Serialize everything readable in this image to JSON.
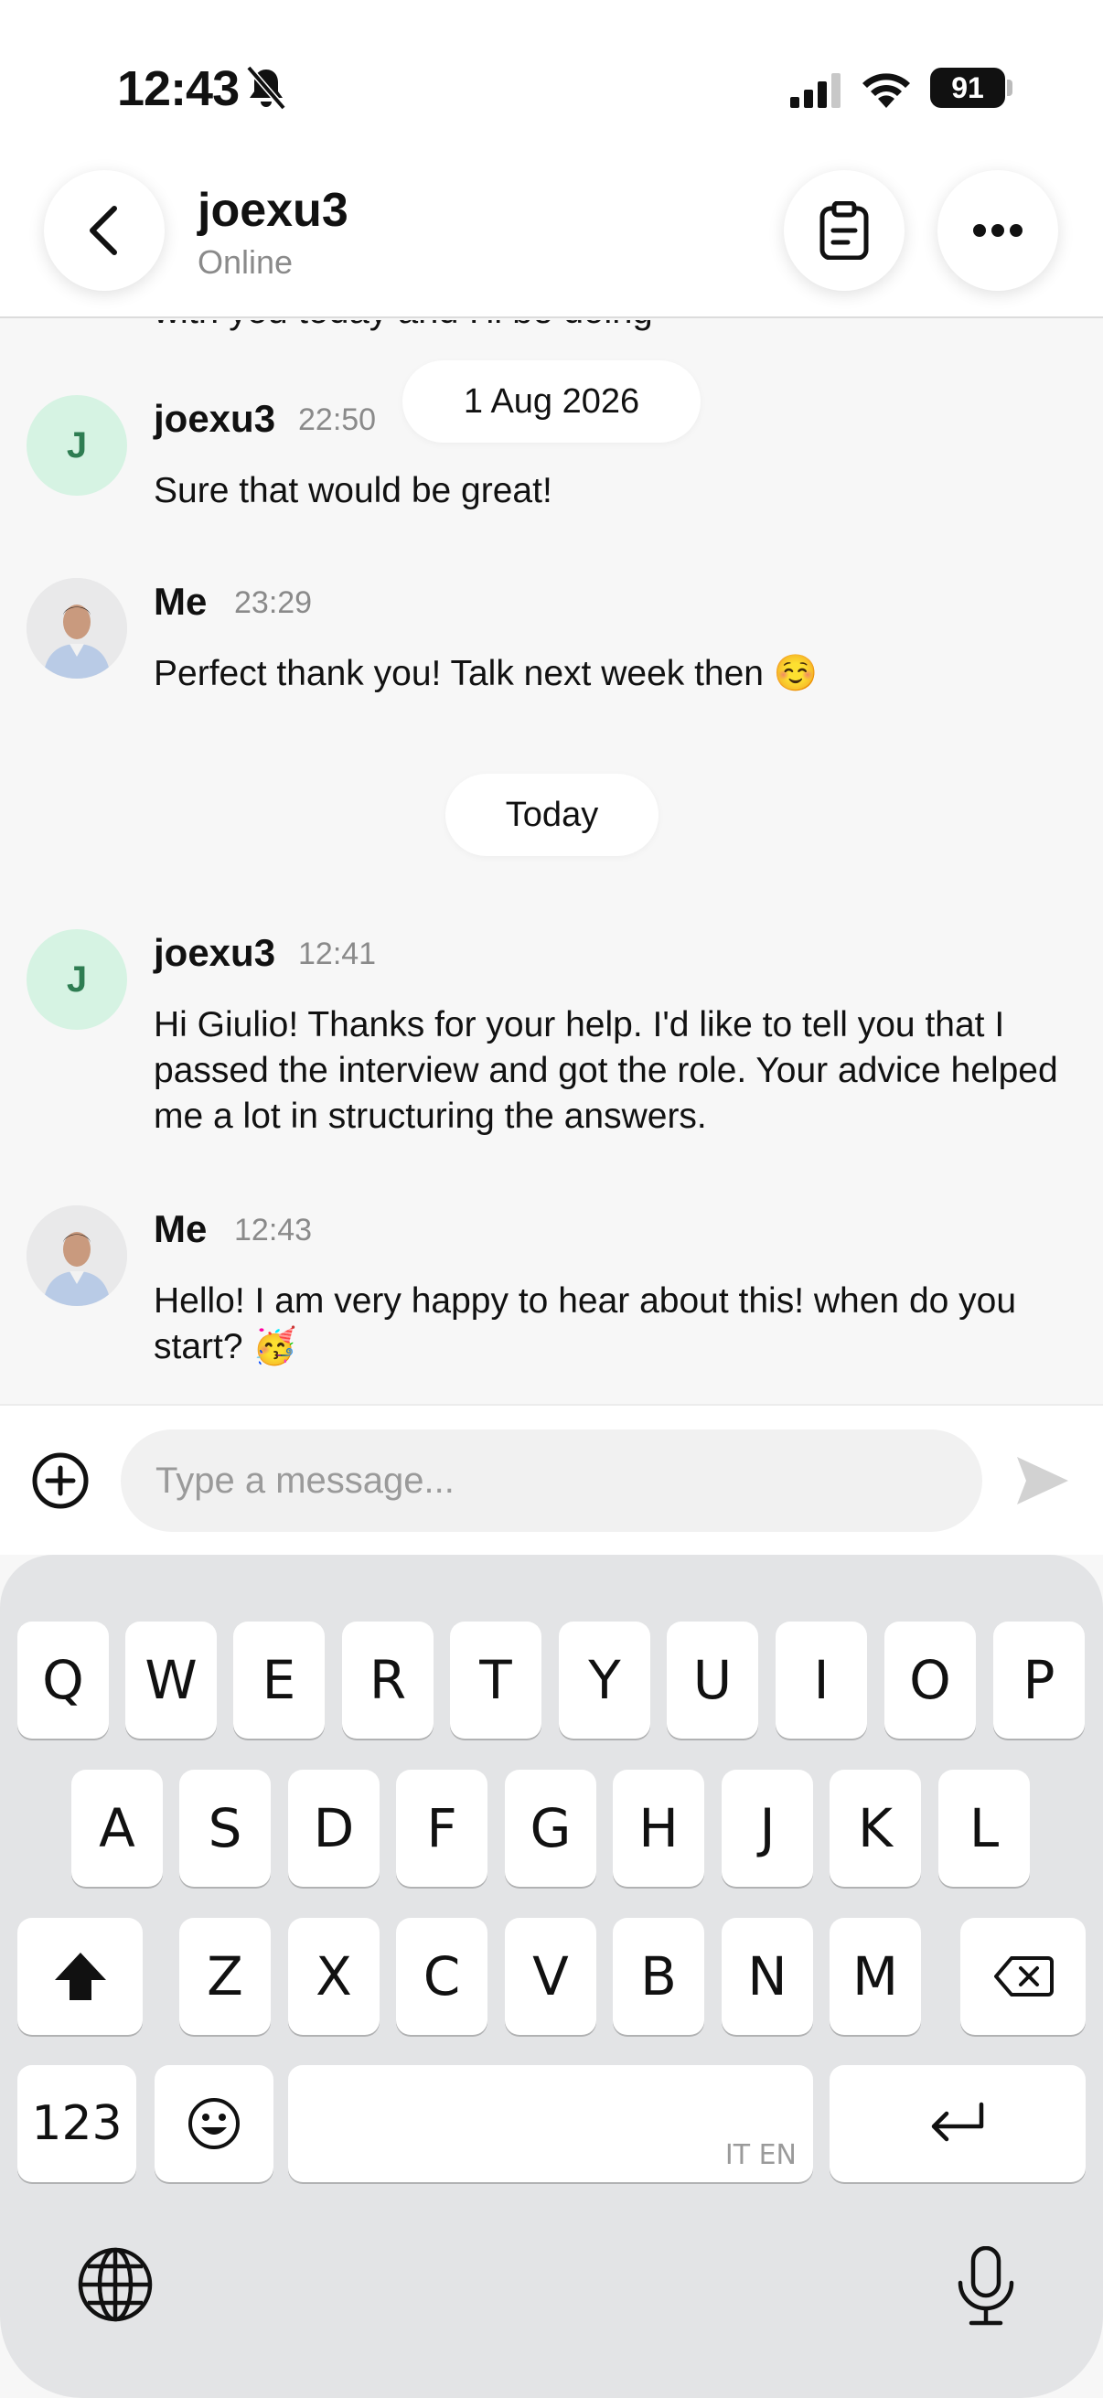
{
  "status_bar": {
    "time": "12:43",
    "battery": "91"
  },
  "header": {
    "name": "joexu3",
    "status": "Online"
  },
  "chat": {
    "cut_text": "with you today and I'll be doing",
    "date_pills": [
      "1 Aug 2026",
      "Today"
    ],
    "messages": [
      {
        "sender": "joexu3",
        "avatar": "J",
        "time": "22:50",
        "text": "Sure that would be great!"
      },
      {
        "sender": "Me",
        "time": "23:29",
        "text": "Perfect thank you! Talk next week then ☺️"
      },
      {
        "sender": "joexu3",
        "avatar": "J",
        "time": "12:41",
        "text": "Hi Giulio! Thanks for your help. I'd like to tell you that I passed the interview and got the role. Your advice helped me a lot in structuring the answers."
      },
      {
        "sender": "Me",
        "time": "12:43",
        "text": "Hello! I am very happy to hear about this! when do you start? 🥳"
      }
    ]
  },
  "input": {
    "placeholder": "Type a message..."
  },
  "keyboard": {
    "row1": [
      "Q",
      "W",
      "E",
      "R",
      "T",
      "Y",
      "U",
      "I",
      "O",
      "P"
    ],
    "row2": [
      "A",
      "S",
      "D",
      "F",
      "G",
      "H",
      "J",
      "K",
      "L"
    ],
    "row3": [
      "Z",
      "X",
      "C",
      "V",
      "B",
      "N",
      "M"
    ],
    "numbers_label": "123",
    "space_lang": "IT EN"
  },
  "icons": {
    "bell": "bell-slash-icon",
    "signal": "signal-icon",
    "wifi": "wifi-icon",
    "back": "chevron-left-icon",
    "clipboard": "clipboard-icon",
    "more": "more-horizontal-icon",
    "add": "plus-circle-icon",
    "send": "send-icon",
    "shift": "shift-icon",
    "backspace": "backspace-icon",
    "emoji": "emoji-icon",
    "return": "return-icon",
    "globe": "globe-icon",
    "mic": "microphone-icon"
  },
  "colors": {
    "avatar_bg": "#d6f3e3",
    "avatar_text": "#2e7d52",
    "keyboard_bg": "#e3e4e6"
  }
}
